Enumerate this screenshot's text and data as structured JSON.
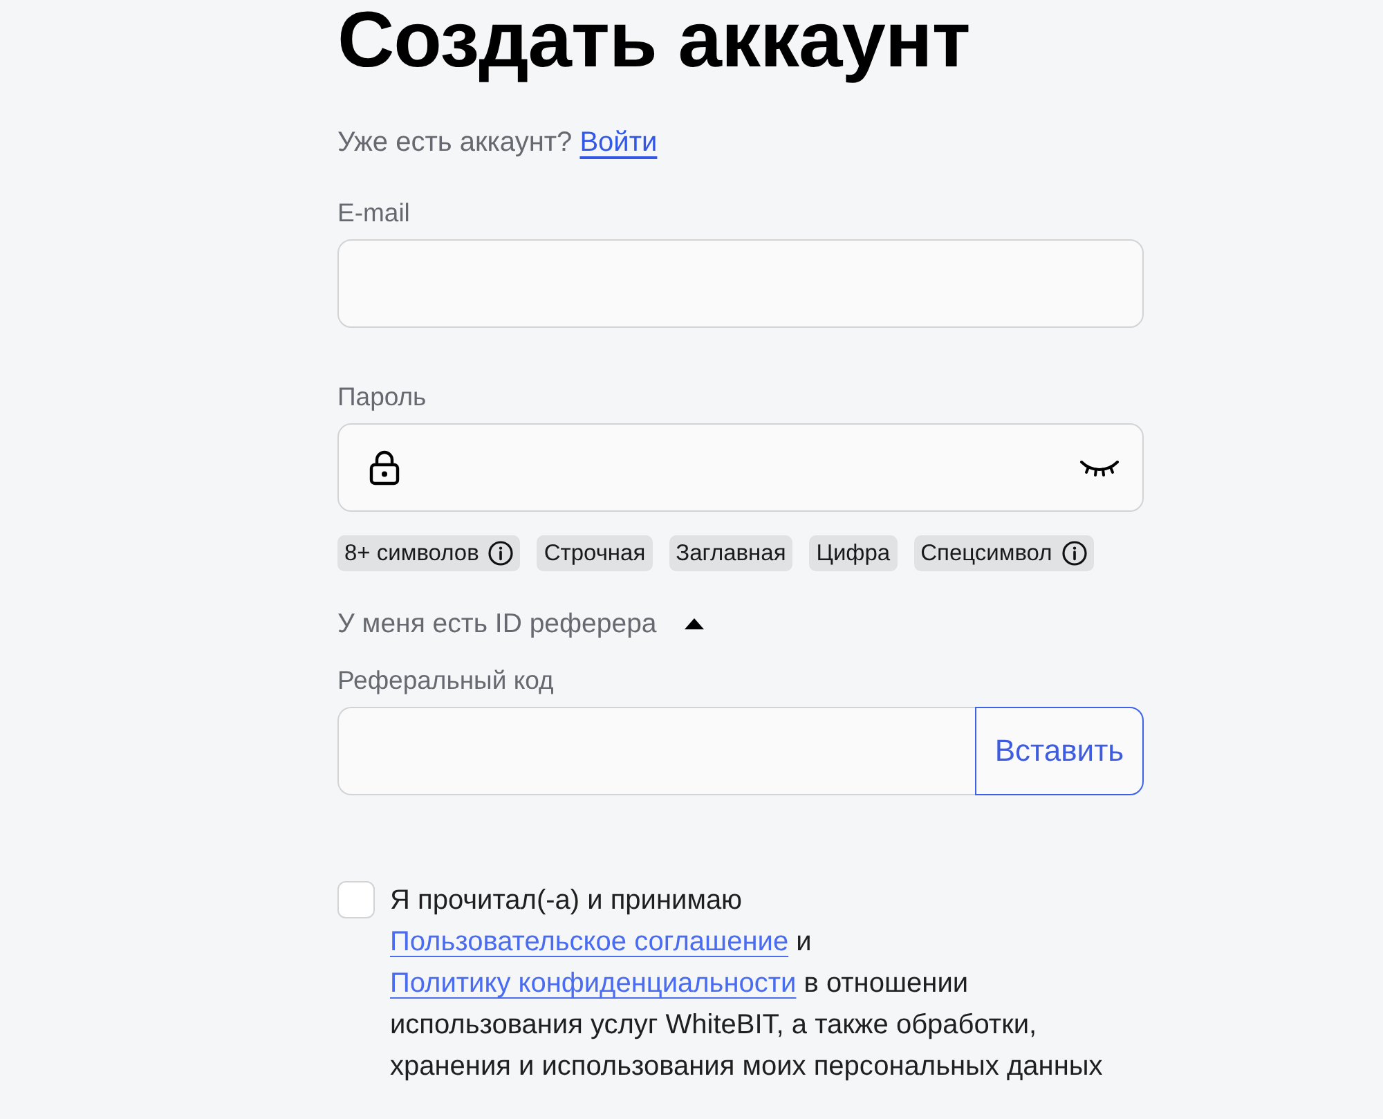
{
  "title": "Создать аккаунт",
  "login_prompt": {
    "text": "Уже есть аккаунт?",
    "link": "Войти"
  },
  "email": {
    "label": "E-mail"
  },
  "password": {
    "label": "Пароль",
    "visible": false
  },
  "password_rules": [
    {
      "label": "8+ символов",
      "info": true
    },
    {
      "label": "Строчная",
      "info": false
    },
    {
      "label": "Заглавная",
      "info": false
    },
    {
      "label": "Цифра",
      "info": false
    },
    {
      "label": "Спецсимвол",
      "info": true
    }
  ],
  "referrer": {
    "toggle": "У меня есть ID реферера",
    "expanded": true,
    "label": "Реферальный код",
    "button": "Вставить"
  },
  "consent": {
    "checked": false,
    "parts": [
      {
        "kind": "text",
        "text": "Я прочитал(-а) и принимаю"
      },
      {
        "kind": "link",
        "text": "Пользовательское соглашение"
      },
      {
        "kind": "text",
        "text": "и"
      },
      {
        "kind": "link",
        "text": "Политику конфиденциальности"
      },
      {
        "kind": "text",
        "text": "в отношении использования услуг WhiteBIT, а также обработки, хранения и использования моих персональных данных"
      }
    ]
  }
}
